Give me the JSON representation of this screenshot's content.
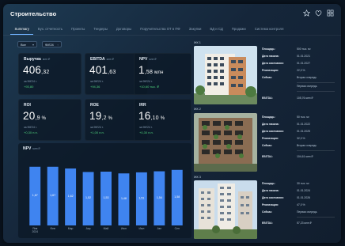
{
  "app": {
    "title": "Строительство"
  },
  "tabs": [
    "Summary",
    "Бух. отчетность",
    "Проекты",
    "Тендеры",
    "Договоры",
    "Поручительства ОТ в ПФ",
    "Закупки",
    "ВД и СД",
    "Продажи",
    "Система контроля"
  ],
  "active_tab": "Summary",
  "filters": {
    "company": "Все",
    "period": "9М'24"
  },
  "kpis": [
    {
      "name": "Выручка",
      "sub": "млн ₽",
      "int": "406",
      "dec": ",32",
      "unit": "",
      "ly": "за 9М'24 г.",
      "delta": "+93,80"
    },
    {
      "name": "EBITDA",
      "sub": "млн ₽",
      "int": "401",
      "dec": ",63",
      "unit": "",
      "ly": "за 9М'24 г.",
      "delta": "+94,36"
    },
    {
      "name": "NPV",
      "sub": "млн ₽",
      "int": "1",
      "dec": ",58",
      "unit": "млн",
      "ly": "за 9М'24 г.",
      "delta": "+10,60 тыс. ₽"
    },
    {
      "name": "ROI",
      "sub": "",
      "int": "20",
      "dec": ",9",
      "unit": "%",
      "ly": "за 9М'24 г.",
      "delta": "+0,30 п.п."
    },
    {
      "name": "ROE",
      "sub": "",
      "int": "19",
      "dec": ",2",
      "unit": "%",
      "ly": "за 9М'24 г.",
      "delta": "+1,00 п.п."
    },
    {
      "name": "IRR",
      "sub": "",
      "int": "16",
      "dec": ",10",
      "unit": "%",
      "ly": "за 9М'24 г.",
      "delta": "+0,30 п.п."
    }
  ],
  "npv_chart": {
    "title": "NPV",
    "sub": "млн ₽"
  },
  "chart_data": {
    "type": "bar",
    "title": "NPV",
    "categories": [
      "Янв 2024",
      "Фев",
      "Мар",
      "Апр",
      "Май",
      "Июн",
      "Июл",
      "Авг",
      "Сен"
    ],
    "values": [
      1.67,
      1.67,
      1.62,
      1.52,
      1.53,
      1.48,
      1.51,
      1.54,
      1.58
    ],
    "value_labels": [
      "1,67",
      "1,67",
      "1,62",
      "1,52",
      "1,53",
      "1,48",
      "1,51",
      "1,54",
      "1,58"
    ],
    "ylim": [
      0,
      1.8
    ],
    "color": "#3f84f0"
  },
  "projects": [
    {
      "label": "ЖК 1",
      "rows": [
        {
          "label": "Площадь:",
          "value": "500 тыс. м²"
        },
        {
          "label": "Дата начала:",
          "value": "01.01.2021"
        },
        {
          "label": "Дата окончания:",
          "value": "01.01.2027"
        },
        {
          "label": "Реализация:",
          "value": "22,0 %"
        },
        {
          "label": "Сейчас:",
          "value": "Вторая очередь"
        },
        {
          "label": "",
          "value": "Первая очередь"
        },
        {
          "label": "EBITDA:",
          "value": "105,76 млн ₽"
        }
      ]
    },
    {
      "label": "ЖК 2",
      "rows": [
        {
          "label": "Площадь:",
          "value": "50 тыс. м²"
        },
        {
          "label": "Дата начала:",
          "value": "01.01.2022"
        },
        {
          "label": "Дата окончания:",
          "value": "01.01.2025"
        },
        {
          "label": "Реализация:",
          "value": "32,0 %"
        },
        {
          "label": "Сейчас:",
          "value": "Вторая очередь"
        },
        {
          "label": "EBITDA:",
          "value": "104,61 млн ₽"
        }
      ]
    },
    {
      "label": "ЖК 3",
      "rows": [
        {
          "label": "Площадь:",
          "value": "30 тыс. м²"
        },
        {
          "label": "Дата начала:",
          "value": "01.01.2024"
        },
        {
          "label": "Дата окончания:",
          "value": "01.01.2026"
        },
        {
          "label": "Реализация:",
          "value": "47,0 %"
        },
        {
          "label": "Сейчас:",
          "value": "Первая очередь"
        },
        {
          "label": "EBITDA:",
          "value": "57,23 млн ₽"
        }
      ]
    }
  ],
  "icons": [
    "star-icon",
    "heart-icon",
    "grid-icon",
    "chevron-down-icon"
  ]
}
